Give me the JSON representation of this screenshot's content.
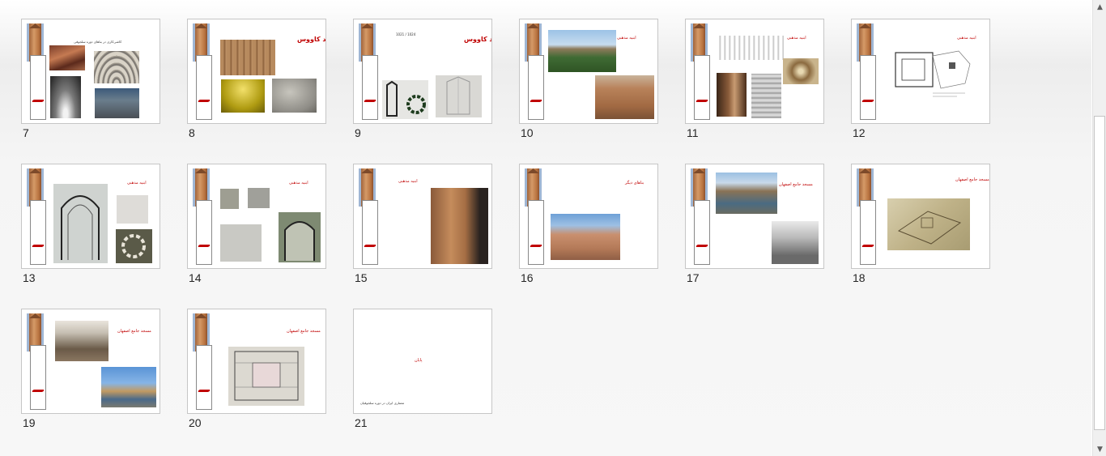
{
  "window": {
    "view": "Slide Sorter"
  },
  "slides": [
    {
      "number": "7",
      "title": "",
      "caption": "کاشی‌کاری در بناهای دوره سلجوقی"
    },
    {
      "number": "8",
      "title": "گنبد کاووس"
    },
    {
      "number": "9",
      "title": "گنبد کاووس",
      "subtitle": "1021 / 1024"
    },
    {
      "number": "10",
      "title": "ابنیه مذهبی"
    },
    {
      "number": "11",
      "title": "ابنیه مذهبی"
    },
    {
      "number": "12",
      "title": "ابنیه مذهبی"
    },
    {
      "number": "13",
      "title": "ابنیه مذهبی"
    },
    {
      "number": "14",
      "title": "ابنیه مذهبی"
    },
    {
      "number": "15",
      "title": "ابنیه مذهبی"
    },
    {
      "number": "16",
      "title": "بناهای دیگر"
    },
    {
      "number": "17",
      "title": "مسجد جامع اصفهان"
    },
    {
      "number": "18",
      "title": "مسجد جامع اصفهان"
    },
    {
      "number": "19",
      "title": "مسجد جامع اصفهان"
    },
    {
      "number": "20",
      "title": "مسجد جامع اصفهان"
    },
    {
      "number": "21",
      "title": "پایان",
      "footer": "معماری ایران در دوره سلجوقیان"
    }
  ],
  "scrollbar": {
    "up_icon": "▲",
    "down_icon": "▼"
  },
  "colors": {
    "accent": "#c00000",
    "border": "#c6c6c6"
  }
}
